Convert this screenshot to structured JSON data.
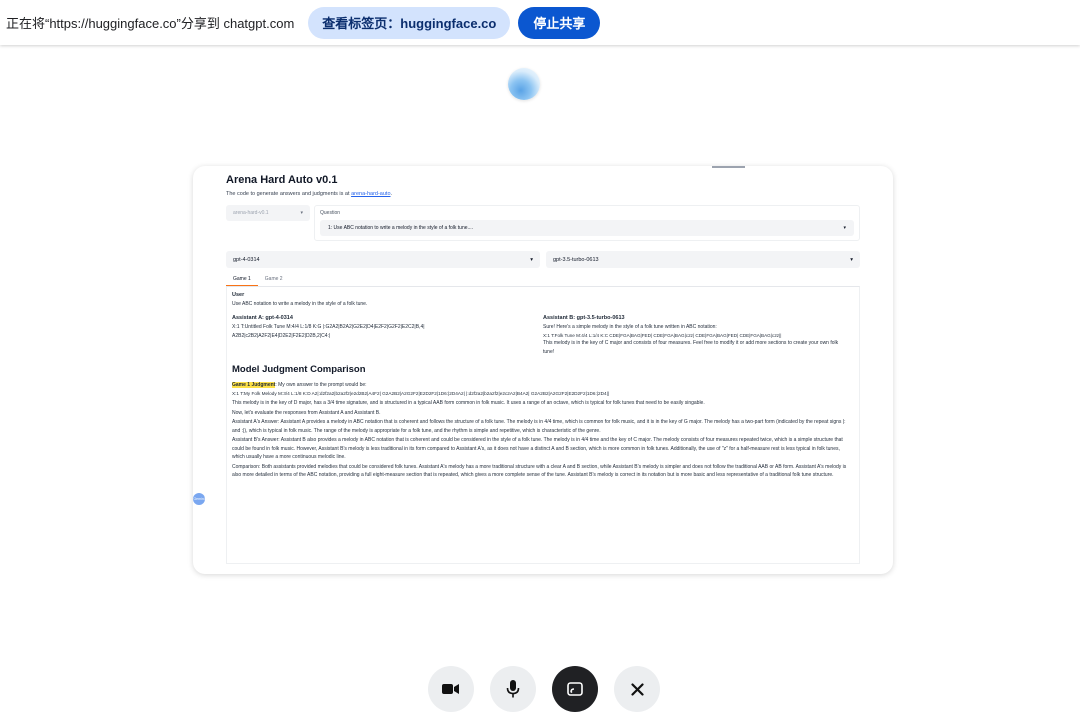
{
  "share_bar": {
    "text": "正在将“https://huggingface.co”分享到 chatgpt.com",
    "view_tab_label": "查看标签页：huggingface.co",
    "stop_label": "停止共享"
  },
  "page": {
    "title": "Arena Hard Auto v0.1",
    "desc_prefix": "The code to generate answers and judgments is at ",
    "desc_link": "arena-hard-auto",
    "desc_suffix": ".",
    "benchmark_select": "arena-hard-v0.1",
    "question_label": "Question",
    "question_select": "1: Use ABC notation to write a melody in the style of a folk tune....",
    "model_a_select": "gpt-4-0314",
    "model_b_select": "gpt-3.5-turbo-0613",
    "tabs": [
      "Game 1",
      "Game 2"
    ]
  },
  "content": {
    "user_label": "User",
    "user_text": "Use ABC notation to write a melody in the style of a folk tune.",
    "assistant_a_label": "Assistant A: gpt-4-0314",
    "assistant_a_line1": "X:1 T:Untitled Folk Tune M:4/4 L:1/8 K:G |:G2A2|B2A2|G2E2|D4|E2F2|G2F2|E2C2|B,4|",
    "assistant_a_line2": "A2B2|c2B2|A2F2|E4|D2E2|F2E2|D2B,2|C4:|",
    "assistant_b_label": "Assistant B: gpt-3.5-turbo-0613",
    "assistant_b_line1": "Sure! Here's a simple melody in the style of a folk tune written in ABC notation:",
    "assistant_b_line2": "X:1 T:Folk Tune M:4/4 L:1/4 K:C CDE|FGA|BAG|FED| CDE|FGA|BAG|c2z| CDE|FGA|BAG|FED| CDE|FGA|BAG|c2z||",
    "assistant_b_line3": "This melody is in the key of C major and consists of four measures. Feel free to modify it or add more sections to create your own folk tune!",
    "section_title": "Model Judgment Comparison",
    "judgment_label": "Game 1 Judgment",
    "judgment_intro": ": My own answer to the prompt would be:",
    "judgment_abc": "X:1 T:My Folk Melody M:3/4 L:1/8 K:D A2|:d2f2a2|b2a2f2|e2d2B2|A4F2| G2A2B2|A2G2F2|E2D2F2|1D6:|2D4A2| |:d2f2a2|b2a2f2|e2c2A2|B4A2| G2A2B2|A2G2F2|E2D2F2|1D6:|2D4||",
    "p1": "This melody is in the key of D major, has a 3/4 time signature, and is structured in a typical AAB form common in folk music. It uses a range of an octave, which is typical for folk tunes that need to be easily singable.",
    "p2": "Now, let's evaluate the responses from Assistant A and Assistant B.",
    "p3": "Assistant A's Answer: Assistant A provides a melody in ABC notation that is coherent and follows the structure of a folk tune. The melody is in 4/4 time, which is common for folk music, and it is in the key of G major. The melody has a two-part form (indicated by the repeat signs |: and :|), which is typical in folk music. The range of the melody is appropriate for a folk tune, and the rhythm is simple and repetitive, which is characteristic of the genre.",
    "p4": "Assistant B's Answer: Assistant B also provides a melody in ABC notation that is coherent and could be considered in the style of a folk tune. The melody is in 4/4 time and the key of C major. The melody consists of four measures repeated twice, which is a simple structure that could be found in folk music. However, Assistant B's melody is less traditional in its form compared to Assistant A's, as it does not have a distinct A and B section, which is more common in folk tunes. Additionally, the use of \"z\" for a half-measure rest is less typical in folk tunes, which usually have a more continuous melodic line.",
    "p5": "Comparison: Both assistants provided melodies that could be considered folk tunes. Assistant A's melody has a more traditional structure with a clear A and B section, while Assistant B's melody is simpler and does not follow the traditional AAB or AB form. Assistant A's melody is also more detailed in terms of the ABC notation, providing a full eight-measure section that is repeated, which gives a more complete sense of the tune. Assistant B's melody is correct in its notation but is more basic and less representative of a traditional folk tune structure."
  },
  "side_dot_label": "Gemini"
}
